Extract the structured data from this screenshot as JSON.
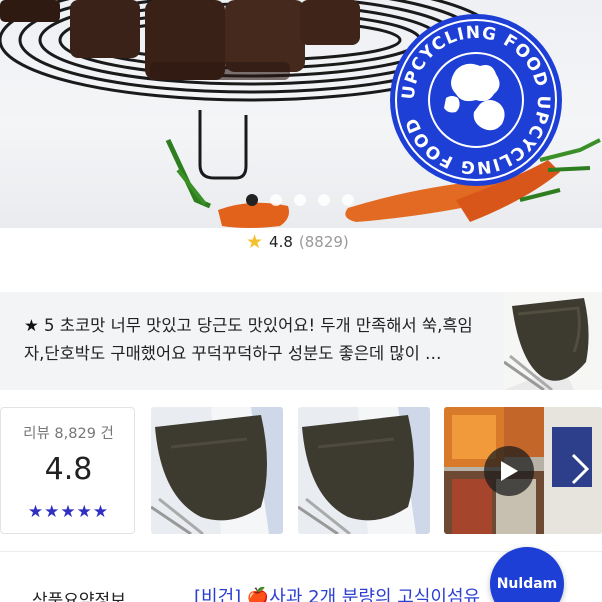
{
  "hero": {
    "badge_text": "UPCYCLING FOOD UPCYCLING FOOD ",
    "carousel": {
      "total": 5,
      "active_index": 0
    },
    "colors": {
      "badge_blue": "#1d3fd6",
      "carrot": "#e2621b",
      "cake": "#3b2218"
    }
  },
  "rating": {
    "score": "4.8",
    "count": "(8829)"
  },
  "review": {
    "star_icon": "★",
    "text": " 5 초코맛 너무 맛있고 당근도 맛있어요! 두개 만족해서 쑥,흑임자,단호박도 구매했어요 꾸덕꾸덕하구 성분도 좋은데 많이 …"
  },
  "summary": {
    "label": "리뷰 8,829 건",
    "score": "4.8",
    "stars": "★★★★★",
    "star_color": "#2f2fc0"
  },
  "strip": {
    "thumbs": [
      "review-photo-1",
      "review-photo-2",
      "review-video"
    ],
    "play_icon": "play-icon",
    "next_icon": "chevron-right-icon"
  },
  "product": {
    "section_label": "상품요약정보",
    "title": "[비건] 🍎사과 2개 분량의 고식이섬유",
    "title_color": "#2b3fd2"
  },
  "fab": {
    "label": "Nuldam"
  }
}
